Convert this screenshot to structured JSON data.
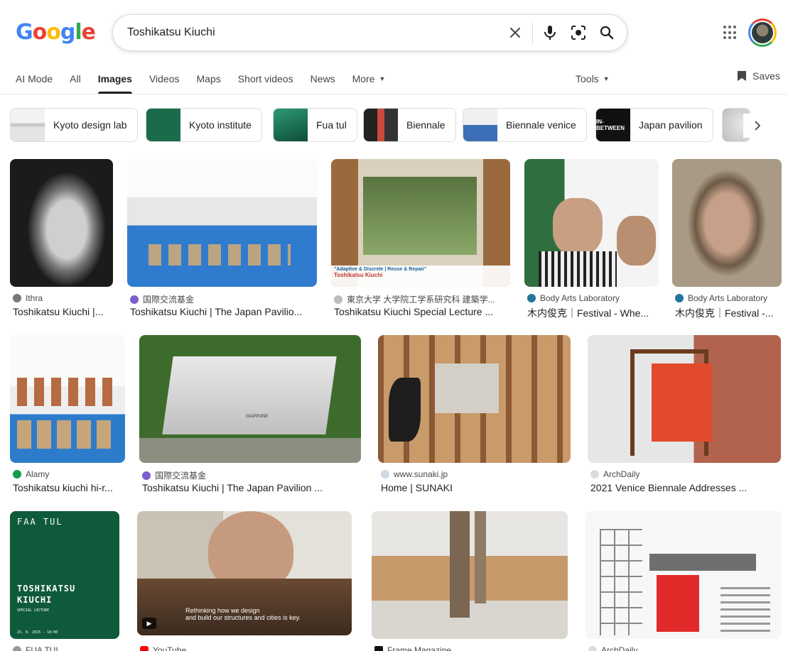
{
  "logo": {
    "letters": [
      "G",
      "o",
      "o",
      "g",
      "l",
      "e"
    ]
  },
  "search": {
    "value": "Toshikatsu Kiuchi",
    "placeholder": ""
  },
  "tabs": [
    {
      "label": "AI Mode"
    },
    {
      "label": "All"
    },
    {
      "label": "Images"
    },
    {
      "label": "Videos"
    },
    {
      "label": "Maps"
    },
    {
      "label": "Short videos"
    },
    {
      "label": "News"
    },
    {
      "label": "More"
    }
  ],
  "tools_label": "Tools",
  "saves_label": "Saves",
  "chips": [
    {
      "label": "Kyoto design lab"
    },
    {
      "label": "Kyoto institute"
    },
    {
      "label": "Fua tul"
    },
    {
      "label": "Biennale"
    },
    {
      "label": "Biennale venice"
    },
    {
      "label": "Japan pavilion"
    }
  ],
  "results": [
    {
      "source": "Ithra",
      "title": "Toshikatsu Kiuchi |..."
    },
    {
      "source": "国際交流基金",
      "title": "Toshikatsu Kiuchi | The Japan Pavilio..."
    },
    {
      "source": "東京大学 大学院工学系研究科 建築学...",
      "title": "Toshikatsu Kiuchi Special Lecture ..."
    },
    {
      "source": "Body Arts Laboratory",
      "title": "木内俊克｜Festival - Whe..."
    },
    {
      "source": "Body Arts Laboratory",
      "title": "木内俊克｜Festival -..."
    },
    {
      "source": "Alamy",
      "title": "Toshikatsu kiuchi hi-r..."
    },
    {
      "source": "国際交流基金",
      "title": "Toshikatsu Kiuchi | The Japan Pavilion ..."
    },
    {
      "source": "www.sunaki.jp",
      "title": "Home | SUNAKI"
    },
    {
      "source": "ArchDaily",
      "title": "2021 Venice Biennale Addresses ..."
    },
    {
      "source": "FUA TUL",
      "title": ""
    },
    {
      "source": "YouTube",
      "title": ""
    },
    {
      "source": "Frame Magazine",
      "title": ""
    },
    {
      "source": "ArchDaily",
      "title": ""
    }
  ],
  "thumb_text": {
    "lecture_title": "\"Adaptive & Discrete | Reuse & Repair\"",
    "lecture_name": "Toshikatsu Kiuchi",
    "chip_betweens": "IN-BETWEEN",
    "pavilion_sign": "GIAPPONE",
    "poster_head": "FAA TUL",
    "poster_name_1": "TOSHIKATSU",
    "poster_name_2": "KIUCHI",
    "poster_sub": "SPECIAL LECTURE",
    "poster_date": "25. 8. 2025 - 18:00",
    "video_caption_1": "Rethinking how we design",
    "video_caption_2": "and build our structures and cities is key."
  },
  "colors": {
    "accent": "#1a73e8",
    "text": "#1f1f1f",
    "muted": "#474747",
    "poster_green": "#0f5a3a"
  }
}
